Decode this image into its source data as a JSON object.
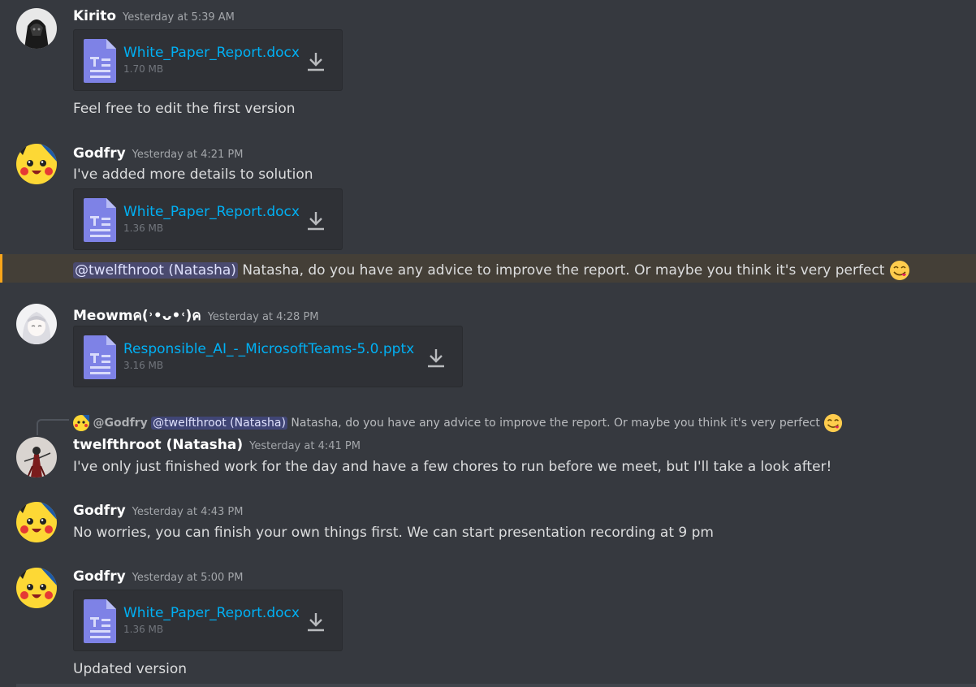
{
  "messages": [
    {
      "username": "Kirito",
      "timestamp": "Yesterday at 5:39 AM",
      "attachment": {
        "name": "White_Paper_Report.docx",
        "size": "1.70 MB"
      },
      "text": "Feel free to edit the first version"
    },
    {
      "username": "Godfry",
      "timestamp": "Yesterday at 4:21 PM",
      "text": "I've added more details to solution",
      "attachment": {
        "name": "White_Paper_Report.docx",
        "size": "1.36 MB"
      },
      "mention_line": {
        "mention": "@twelfthroot (Natasha)",
        "text": "Natasha, do you have any advice to improve the report. Or maybe you think it's very perfect"
      }
    },
    {
      "username": "Meowmคʕ•̫͡•ʔค",
      "username_display": "Meowmค(˒•ᴗ•˓)ค",
      "timestamp": "Yesterday at 4:28 PM",
      "attachment": {
        "name": "Responsible_AI_-_MicrosoftTeams-5.0.pptx",
        "size": "3.16 MB"
      }
    },
    {
      "reply": {
        "author": "@Godfry",
        "mention": "@twelfthroot (Natasha)",
        "text": "Natasha, do you have any advice to improve the report. Or maybe you think it's very perfect"
      },
      "username": "twelfthroot (Natasha)",
      "timestamp": "Yesterday at 4:41 PM",
      "text": "I've only just finished work for the day and have a few chores to run before we meet, but I'll take a look after!"
    },
    {
      "username": "Godfry",
      "timestamp": "Yesterday at 4:43 PM",
      "text": "No worries, you can finish your own things first. We can start presentation recording at 9 pm"
    },
    {
      "username": "Godfry",
      "timestamp": "Yesterday at 5:00 PM",
      "attachment": {
        "name": "White_Paper_Report.docx",
        "size": "1.36 MB"
      },
      "text": "Updated version"
    }
  ],
  "icons": {
    "file": "document-icon",
    "download": "download-icon",
    "emoji": "yum-face-emoji"
  },
  "colors": {
    "background": "#36393f",
    "link": "#00b0f4",
    "mention_highlight": "#faa61a"
  }
}
